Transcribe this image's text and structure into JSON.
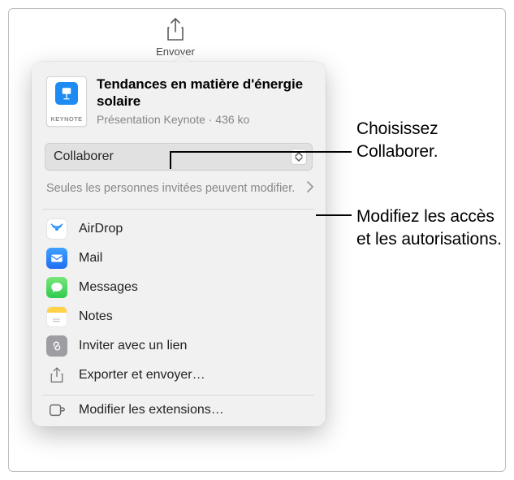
{
  "toolbar": {
    "share_label": "Envoyer"
  },
  "file": {
    "type_badge": "KEYNOTE",
    "title": "Tendances en matière d'énergie solaire",
    "subtitle": "Présentation Keynote · 436 ko"
  },
  "collaborate": {
    "selected": "Collaborer"
  },
  "permissions": {
    "summary": "Seules les personnes invitées peuvent modifier."
  },
  "share_targets": [
    {
      "id": "airdrop",
      "label": "AirDrop"
    },
    {
      "id": "mail",
      "label": "Mail"
    },
    {
      "id": "messages",
      "label": "Messages"
    },
    {
      "id": "notes",
      "label": "Notes"
    },
    {
      "id": "link",
      "label": "Inviter avec un lien"
    },
    {
      "id": "export",
      "label": "Exporter et envoyer…"
    }
  ],
  "extensions": {
    "label": "Modifier les extensions…"
  },
  "callouts": {
    "top": "Choisissez Collaborer.",
    "bottom": "Modifiez les accès et les autorisations."
  },
  "colors": {
    "accent": "#1d8bf2",
    "airdrop": "#2e91ff",
    "mail": "#2a7ff3",
    "messages": "#3bd05a",
    "notes_header": "#ffd24a",
    "link_bg": "#9d9da2"
  }
}
